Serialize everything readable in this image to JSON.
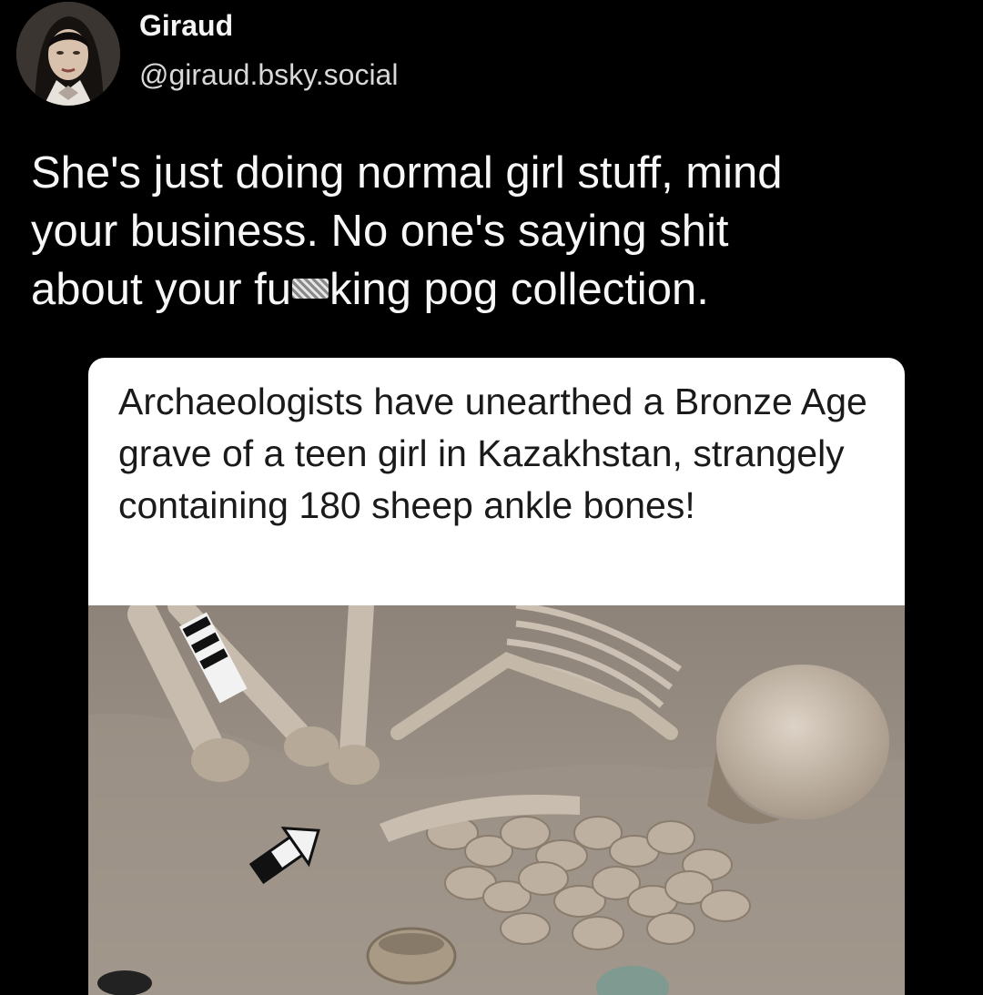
{
  "author": {
    "display_name": "Giraud",
    "handle": "@giraud.bsky.social"
  },
  "post": {
    "line1": "She's just doing normal girl stuff, mind",
    "line2": "your business. No one's saying shit",
    "line3_prefix": "about your fu",
    "line3_suffix": "king pog collection."
  },
  "embedded_image": {
    "caption": "Archaeologists have unearthed a Bronze Age grave of a teen girl in Kazakhstan, strangely containing 180 sheep ankle bones!"
  },
  "colors": {
    "background": "#000000",
    "text": "#f7f7f7",
    "card": "#ffffff",
    "soil": "#9a8f84"
  }
}
